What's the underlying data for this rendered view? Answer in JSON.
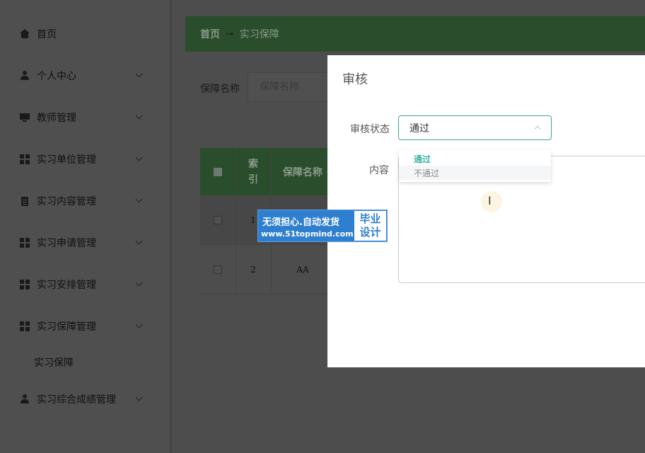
{
  "sidebar": {
    "items": [
      {
        "label": "首页",
        "icon": "home-icon",
        "has_chevron": false
      },
      {
        "label": "个人中心",
        "icon": "user-icon",
        "has_chevron": true
      },
      {
        "label": "教师管理",
        "icon": "monitor-icon",
        "has_chevron": true
      },
      {
        "label": "实习单位管理",
        "icon": "grid-icon",
        "has_chevron": true
      },
      {
        "label": "实习内容管理",
        "icon": "clipboard-icon",
        "has_chevron": true
      },
      {
        "label": "实习申请管理",
        "icon": "grid-icon",
        "has_chevron": true
      },
      {
        "label": "实习安排管理",
        "icon": "grid-icon",
        "has_chevron": true
      },
      {
        "label": "实习保障管理",
        "icon": "grid-icon",
        "has_chevron": true
      },
      {
        "label": "实习综合成绩管理",
        "icon": "user-icon",
        "has_chevron": true
      }
    ],
    "subitem": "实习保障"
  },
  "breadcrumb": {
    "home": "首页",
    "arrow": "→",
    "current": "实习保障"
  },
  "search": {
    "label": "保障名称",
    "placeholder": "保障名称"
  },
  "table": {
    "headers": {
      "index": "索\n引",
      "name": "保障名称"
    },
    "rows": [
      {
        "index": "1",
        "name": ""
      },
      {
        "index": "2",
        "name": "AA"
      }
    ]
  },
  "dialog": {
    "title": "审核",
    "status_label": "审核状态",
    "status_value": "通过",
    "content_label": "内容",
    "options": [
      "通过",
      "不通过"
    ]
  },
  "watermark": {
    "line1": "无须担心.自动发货",
    "line2": "www.51topmind.com",
    "badge_line1": "毕业",
    "badge_line2": "设计"
  },
  "colors": {
    "accent": "#3bb4a2",
    "header_green": "#2a4d2c",
    "watermark_blue": "#2f7fd0"
  }
}
